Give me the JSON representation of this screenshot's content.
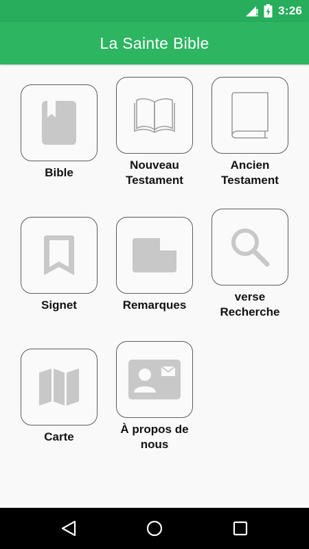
{
  "status_bar": {
    "time": "3:26"
  },
  "app_bar": {
    "title": "La Sainte Bible"
  },
  "tiles": [
    {
      "label_lines": [
        "Bible"
      ],
      "icon": "book-icon"
    },
    {
      "label_lines": [
        "Nouveau",
        "Testament"
      ],
      "icon": "open-book-icon"
    },
    {
      "label_lines": [
        "Ancien",
        "Testament"
      ],
      "icon": "closed-book-icon"
    },
    {
      "label_lines": [
        "Signet"
      ],
      "icon": "bookmark-icon"
    },
    {
      "label_lines": [
        "Remarques"
      ],
      "icon": "note-icon"
    },
    {
      "label_lines": [
        "verse",
        "Recherche"
      ],
      "icon": "search-icon"
    },
    {
      "label_lines": [
        "Carte"
      ],
      "icon": "map-icon"
    },
    {
      "label_lines": [
        "À propos de",
        "nous"
      ],
      "icon": "contact-card-icon"
    }
  ],
  "colors": {
    "primary": "#2db562",
    "status_bar": "#27ad5c",
    "icon_gray": "#c8c8c8"
  }
}
